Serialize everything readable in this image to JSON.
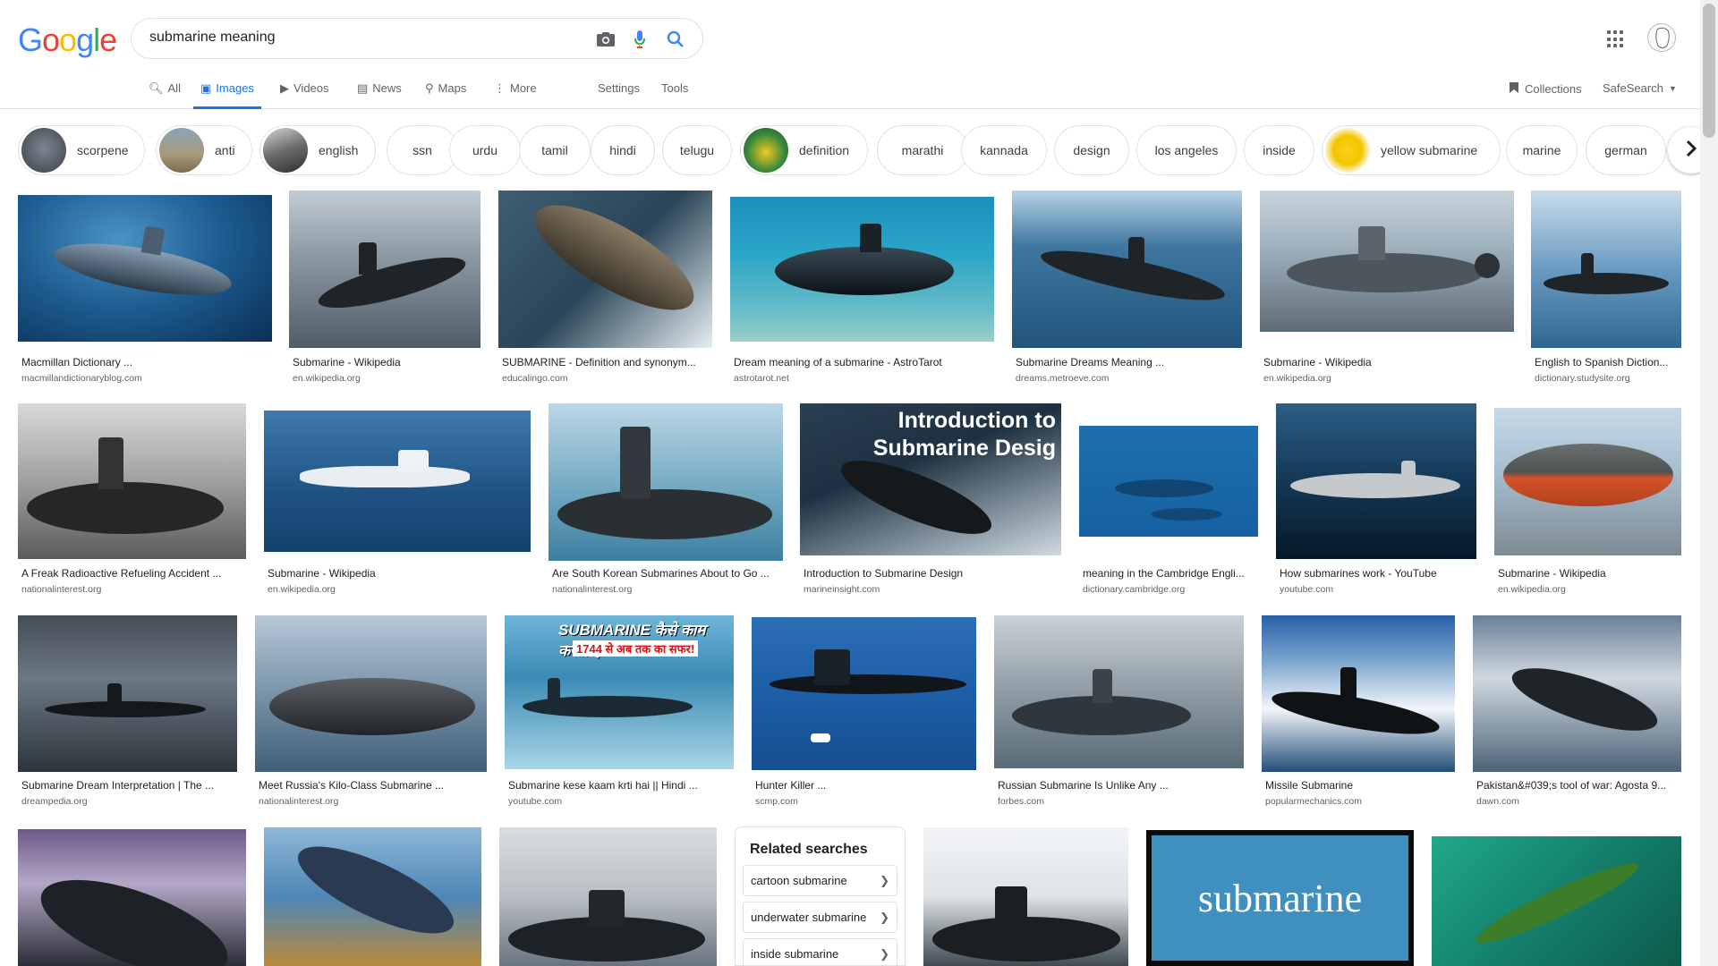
{
  "logo_letters": [
    "G",
    "o",
    "o",
    "g",
    "l",
    "e"
  ],
  "search": {
    "query": "submarine meaning"
  },
  "nav": {
    "tabs": [
      "All",
      "Images",
      "Videos",
      "News",
      "Maps",
      "More"
    ],
    "settings": "Settings",
    "tools": "Tools",
    "collections": "Collections",
    "safesearch": "SafeSearch"
  },
  "chips": [
    "scorpene",
    "anti",
    "english",
    "ssn",
    "urdu",
    "tamil",
    "hindi",
    "telugu",
    "definition",
    "marathi",
    "kannada",
    "design",
    "los angeles",
    "inside",
    "yellow submarine",
    "marine",
    "german"
  ],
  "results": [
    {
      "cap": "Macmillan Dictionary ...",
      "src": "macmillandictionaryblog.com"
    },
    {
      "cap": "Submarine - Wikipedia",
      "src": "en.wikipedia.org"
    },
    {
      "cap": "SUBMARINE - Definition and synonym...",
      "src": "educalingo.com"
    },
    {
      "cap": "Dream meaning of a submarine - AstroTarot",
      "src": "astrotarot.net"
    },
    {
      "cap": "Submarine Dreams Meaning ...",
      "src": "dreams.metroeve.com"
    },
    {
      "cap": "Submarine - Wikipedia",
      "src": "en.wikipedia.org"
    },
    {
      "cap": "English to Spanish Diction...",
      "src": "dictionary.studysite.org"
    },
    {
      "cap": "A Freak Radioactive Refueling Accident ...",
      "src": "nationalinterest.org"
    },
    {
      "cap": "Submarine - Wikipedia",
      "src": "en.wikipedia.org"
    },
    {
      "cap": "Are South Korean Submarines About to Go ...",
      "src": "nationalinterest.org"
    },
    {
      "cap": "Introduction to Submarine Design",
      "src": "marineinsight.com"
    },
    {
      "cap": "meaning in the Cambridge Engli...",
      "src": "dictionary.cambridge.org"
    },
    {
      "cap": "How submarines work - YouTube",
      "src": "youtube.com"
    },
    {
      "cap": "Submarine - Wikipedia",
      "src": "en.wikipedia.org"
    },
    {
      "cap": "Submarine Dream Interpretation | The ...",
      "src": "dreampedia.org"
    },
    {
      "cap": "Meet Russia's Kilo-Class Submarine ...",
      "src": "nationalinterest.org"
    },
    {
      "cap": "Submarine kese kaam krti hai || Hindi ...",
      "src": "youtube.com"
    },
    {
      "cap": "Hunter Killer ...",
      "src": "scmp.com"
    },
    {
      "cap": "Russian Submarine Is Unlike Any ...",
      "src": "forbes.com"
    },
    {
      "cap": "Missile Submarine",
      "src": "popularmechanics.com"
    },
    {
      "cap": "Pakistan&#039;s tool of war: Agosta 9...",
      "src": "dawn.com"
    }
  ],
  "image_overlays": {
    "intro_line1": "Introduction to",
    "intro_line2": "Submarine Desig",
    "hindi_title": "SUBMARINE कैसे काम करती है?",
    "hindi_sub": "1744 से अब तक का सफर!",
    "word_card": "submarine",
    "definition_chip_thumb": "The Beatles Yellow Submarine"
  },
  "related": {
    "title": "Related searches",
    "items": [
      "cartoon submarine",
      "underwater submarine",
      "inside submarine"
    ]
  },
  "colors": {
    "accent": "#1a73e8",
    "border": "#dfe1e5",
    "muted": "#5f6368"
  }
}
